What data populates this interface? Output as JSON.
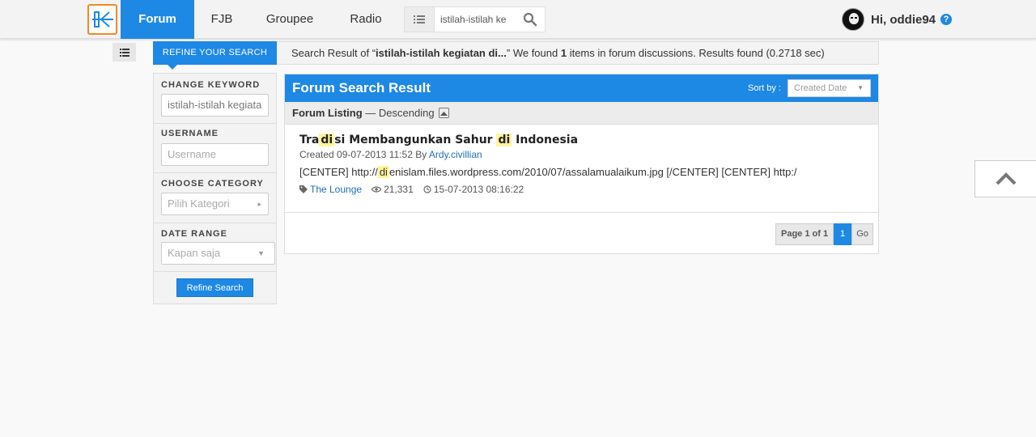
{
  "header": {
    "logo_icon": "kaskus-logo-icon",
    "nav": [
      {
        "label": "Forum",
        "active": true
      },
      {
        "label": "FJB"
      },
      {
        "label": "Groupee"
      },
      {
        "label": "Radio"
      }
    ],
    "search": {
      "value": "istilah-istilah ke",
      "icon": "search-icon",
      "list_icon": "list-icon"
    },
    "user": {
      "greeting": "Hi, oddie94",
      "help_label": "?"
    }
  },
  "toolbar": {
    "toggle_icon": "list-icon"
  },
  "refine_tab": {
    "label": "REFINE YOUR SEARCH"
  },
  "summary": {
    "prefix": "Search Result of “",
    "keyword": "istilah-istilah kegiatan di...",
    "middle": "” We found ",
    "count": "1",
    "suffix": " items in forum discussions. Results found (0.2718 sec)"
  },
  "sidebar": {
    "keyword_label": "CHANGE KEYWORD",
    "keyword_value": "istilah-istilah kegiata",
    "username_label": "USERNAME",
    "username_placeholder": "Username",
    "category_label": "CHOOSE CATEGORY",
    "category_value": "Pilih Kategori",
    "date_label": "DATE RANGE",
    "date_value": "Kapan saja",
    "button_label": "Refine Search"
  },
  "main": {
    "title": "Forum Search Result",
    "sort_label": "Sort by :",
    "sort_value": "Created Date",
    "listing_label": "Forum Listing",
    "listing_order": " — Descending"
  },
  "post": {
    "title_parts": [
      "Tra",
      "di",
      "si Membangunkan Sahur ",
      "di",
      " Indonesia"
    ],
    "meta_created": "Created 09-07-2013 11:52 By ",
    "meta_author": "Ardy.civillian",
    "snippet_before": "[CENTER] http://",
    "snippet_hl": "di",
    "snippet_after": "enislam.files.wordpress.com/2010/07/assalamualaikum.jpg [/CENTER] [CENTER] http:/",
    "category": "The Lounge",
    "views": "21,331",
    "last_date": "15-07-2013 08:16:22"
  },
  "pager": {
    "info": "Page 1 of 1",
    "current": "1",
    "go": "Go"
  },
  "colors": {
    "primary": "#1e88e5",
    "logo_accent": "#f08a24",
    "highlight": "#fff59d"
  }
}
